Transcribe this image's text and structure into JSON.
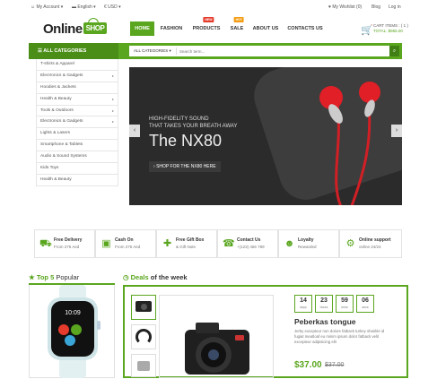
{
  "topbar": {
    "account": "My Account",
    "language": "English",
    "currency": "€ USD",
    "wishlist": "My Wishlist (0)",
    "blog": "Blog",
    "login": "Log in"
  },
  "header": {
    "logo_main": "Online",
    "logo_shop": "SHOP",
    "nav": [
      {
        "label": "HOME",
        "badge": ""
      },
      {
        "label": "FASHION",
        "badge": ""
      },
      {
        "label": "PRODUCTS",
        "badge": "NEW"
      },
      {
        "label": "SALE",
        "badge": "HOT"
      },
      {
        "label": "ABOUT US",
        "badge": ""
      },
      {
        "label": "CONTACTS US",
        "badge": ""
      }
    ],
    "cart_items": "CART ITEMS : ( 1 )",
    "cart_total": "TOTAL: $955.00"
  },
  "categories_label": "ALL CATEGORIES",
  "search": {
    "category": "ALL CATEGORIES",
    "placeholder": "Search term..."
  },
  "sidebar": [
    {
      "label": "T-shirts & Apparel",
      "arrow": false
    },
    {
      "label": "Electronics & Gadgets",
      "arrow": true
    },
    {
      "label": "Hoodies & Jackets",
      "arrow": false
    },
    {
      "label": "Health & Beauty",
      "arrow": true
    },
    {
      "label": "Tools & Outdoors",
      "arrow": true
    },
    {
      "label": "Electronics & Gadgets",
      "arrow": true
    },
    {
      "label": "Lights & Lasers",
      "arrow": false
    },
    {
      "label": "Smartphone & Tablets",
      "arrow": false
    },
    {
      "label": "Audio & Sound Systems",
      "arrow": false
    },
    {
      "label": "Kids Toys",
      "arrow": false
    },
    {
      "label": "Health & Beauty",
      "arrow": false
    }
  ],
  "hero": {
    "line1": "HIGH-FIDELITY SOUND",
    "line2": "THAT TAKES YOUR BREATH AWAY",
    "title": "The NX80",
    "button": "SHOP FOR THE NX80 HERE"
  },
  "features": [
    {
      "icon": "truck-icon",
      "title": "Free Delivery",
      "sub": "From 275 Aed"
    },
    {
      "icon": "cash-icon",
      "title": "Cash On",
      "sub": "From 275 Aed"
    },
    {
      "icon": "gift-icon",
      "title": "Free Gift Box",
      "sub": "& Gift Note"
    },
    {
      "icon": "phone-icon",
      "title": "Contact Us",
      "sub": "+(123) 456 789"
    },
    {
      "icon": "users-icon",
      "title": "Loyalty",
      "sub": "Rewarded"
    },
    {
      "icon": "gear-icon",
      "title": "Online support",
      "sub": "online 24/24"
    }
  ],
  "top5": {
    "title": "Top 5",
    "title2": "Popular"
  },
  "deals": {
    "title": "Deals",
    "title2": "of the week"
  },
  "timer": [
    {
      "value": "14",
      "unit": "days"
    },
    {
      "value": "23",
      "unit": "hours"
    },
    {
      "value": "59",
      "unit": "mins"
    },
    {
      "value": "06",
      "unit": "secs"
    }
  ],
  "deal_product": {
    "name": "Peberkas tongue",
    "desc": "Jerky excepteur non dolore fatback turkey shankle id fugiat meatloaf eu minim ipsum dolor fatback velit excepteur adipisicing elit",
    "price": "$37.00",
    "old_price": "$37.00"
  },
  "colors": {
    "accent": "#5aa61f",
    "new": "#e53b2c",
    "hot": "#f39c12"
  }
}
